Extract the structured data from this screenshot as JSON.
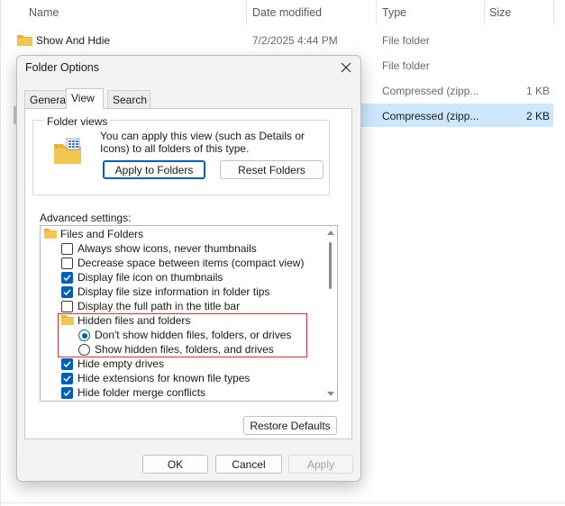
{
  "explorer": {
    "columns": {
      "name": "Name",
      "date": "Date modified",
      "type": "Type",
      "size": "Size"
    },
    "rows": [
      {
        "name": "Show And Hdie",
        "date": "7/2/2025 4:44 PM",
        "type": "File folder",
        "size": ""
      },
      {
        "name": "",
        "date": "",
        "type": "File folder",
        "size": ""
      },
      {
        "name": "",
        "date": "",
        "type": "Compressed (zipp...",
        "size": "1 KB"
      },
      {
        "name": "",
        "date": "",
        "type": "Compressed (zipp...",
        "size": "2 KB"
      }
    ],
    "selected_row": 3
  },
  "dialog": {
    "title": "Folder Options",
    "tabs": [
      "General",
      "View",
      "Search"
    ],
    "active_tab": "View",
    "folder_views": {
      "legend": "Folder views",
      "text": "You can apply this view (such as Details or Icons) to all folders of this type.",
      "apply_label": "Apply to Folders",
      "reset_label": "Reset Folders"
    },
    "advanced_label": "Advanced settings:",
    "tree": [
      {
        "kind": "folder",
        "label": "Files and Folders",
        "indent": 0
      },
      {
        "kind": "checkbox",
        "label": "Always show icons, never thumbnails",
        "checked": false,
        "indent": 1
      },
      {
        "kind": "checkbox",
        "label": "Decrease space between items (compact view)",
        "checked": false,
        "indent": 1
      },
      {
        "kind": "checkbox",
        "label": "Display file icon on thumbnails",
        "checked": true,
        "indent": 1
      },
      {
        "kind": "checkbox",
        "label": "Display file size information in folder tips",
        "checked": true,
        "indent": 1
      },
      {
        "kind": "checkbox",
        "label": "Display the full path in the title bar",
        "checked": false,
        "indent": 1
      },
      {
        "kind": "folder",
        "label": "Hidden files and folders",
        "indent": 1
      },
      {
        "kind": "radio",
        "label": "Don't show hidden files, folders, or drives",
        "checked": true,
        "indent": 2
      },
      {
        "kind": "radio",
        "label": "Show hidden files, folders, and drives",
        "checked": false,
        "indent": 2
      },
      {
        "kind": "checkbox",
        "label": "Hide empty drives",
        "checked": true,
        "indent": 1
      },
      {
        "kind": "checkbox",
        "label": "Hide extensions for known file types",
        "checked": true,
        "indent": 1
      },
      {
        "kind": "checkbox",
        "label": "Hide folder merge conflicts",
        "checked": true,
        "indent": 1
      }
    ],
    "restore_label": "Restore Defaults",
    "ok_label": "OK",
    "cancel_label": "Cancel",
    "apply_label": "Apply",
    "colors": {
      "accent": "#005fb8",
      "highlight_box": "#d13438",
      "folder": "#f3c64d"
    }
  }
}
